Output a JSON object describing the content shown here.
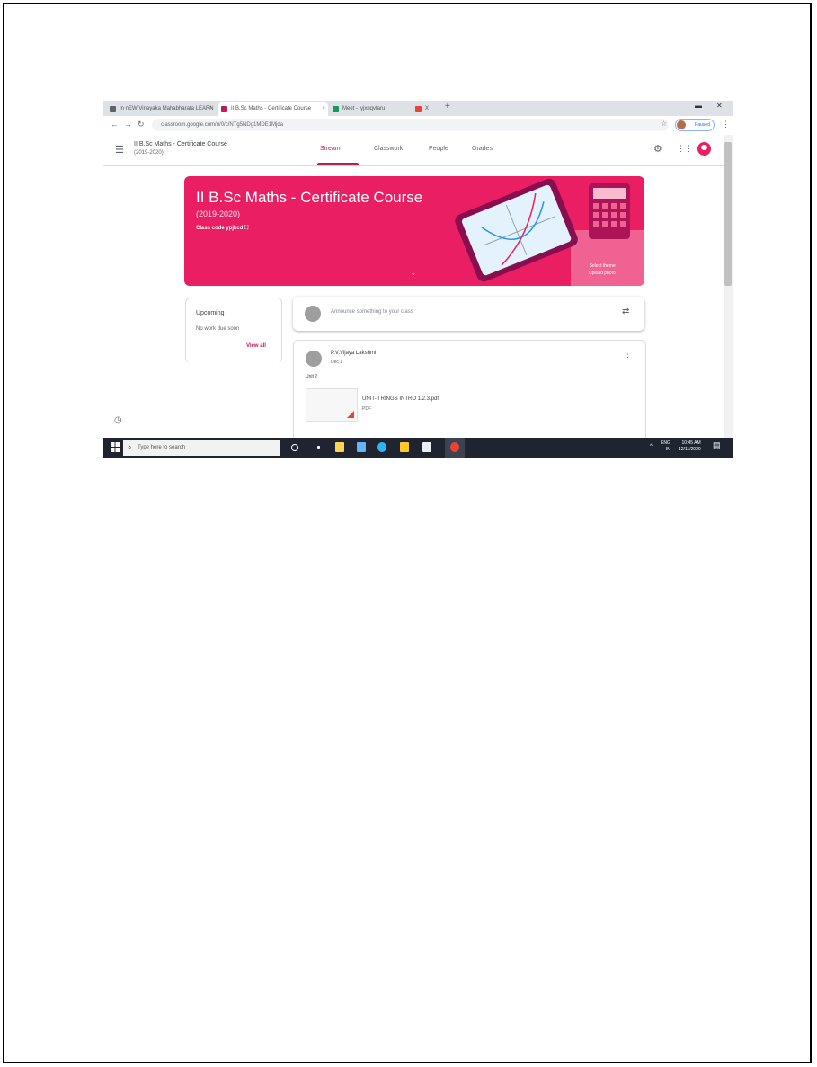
{
  "browser": {
    "tabs": [
      {
        "label": "In nEW Vinayaka Mahabharata LEARN",
        "favicon_color": "#5f6368"
      },
      {
        "label": "II B.Sc Maths - Certificate Course",
        "favicon_color": "#c2185b"
      },
      {
        "label": "Meet - jyjxnqvtaru",
        "favicon_color": "#0f9d58"
      },
      {
        "label": "X",
        "favicon_color": "#ea4335"
      }
    ],
    "new_tab": "+",
    "url": "classroom.google.com/u/0/c/NTg5NDg1MDE1Mjda",
    "profile_label": "Paused"
  },
  "classroom": {
    "class_name": "II B.Sc Maths - Certificate Course",
    "class_sub": "(2019-2020)",
    "tabs": [
      {
        "label": "Stream",
        "active": true
      },
      {
        "label": "Classwork",
        "active": false
      },
      {
        "label": "People",
        "active": false
      },
      {
        "label": "Grades",
        "active": false
      }
    ],
    "banner": {
      "title": "II B.Sc Maths - Certificate Course",
      "year": "(2019-2020)",
      "class_code": "Class code  ypjkcd",
      "select_theme": "Select theme",
      "upload_photo": "Upload photo",
      "color": "#e91e63"
    },
    "upcoming": {
      "title": "Upcoming",
      "text": "No work due soon",
      "view_all": "View all"
    },
    "announce_placeholder": "Announce something to your class",
    "post": {
      "author": "P.V.Vijaya Lakshmi",
      "date": "Dec 1",
      "body": "Unit 2",
      "attachment_name": "UNIT-II RINGS INTRO 1.2.3.pdf",
      "attachment_type": "PDF"
    }
  },
  "taskbar": {
    "search_placeholder": "Type here to search",
    "tray_lang": "ENG",
    "tray_region": "IN",
    "time": "10:45 AM",
    "date": "12/11/2020"
  },
  "colors": {
    "accent": "#c2185b",
    "taskbar": "#1f2430"
  }
}
